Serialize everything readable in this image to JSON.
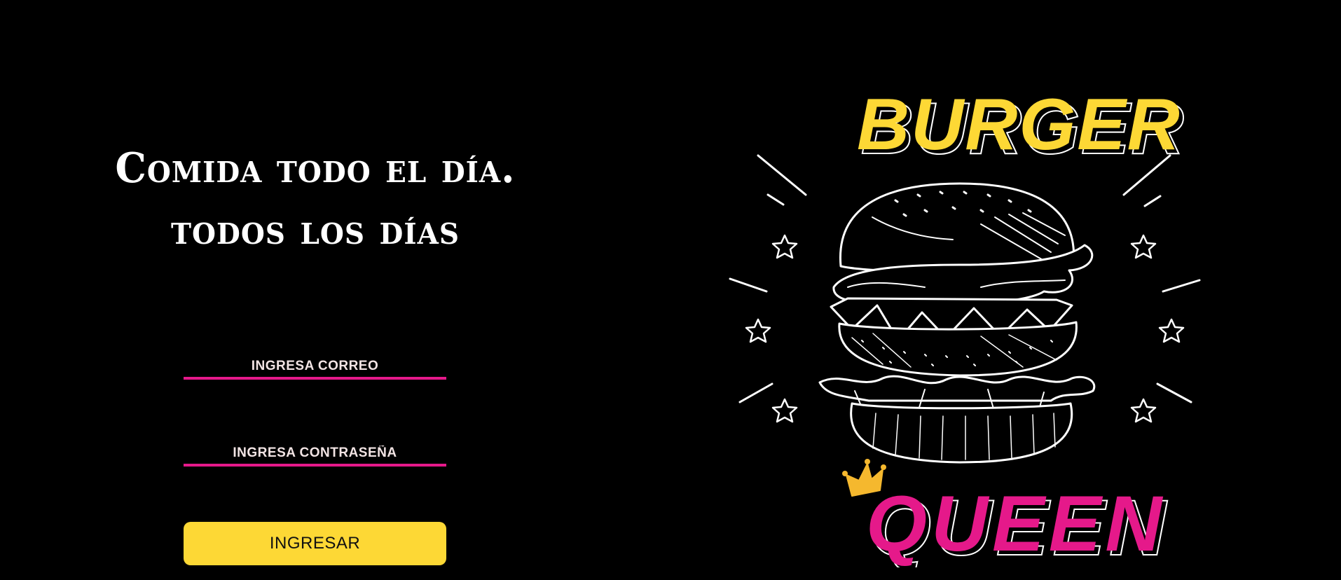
{
  "tagline": {
    "line1": "Comida todo el día.",
    "line2": "todos los días"
  },
  "login": {
    "email_placeholder": "INGRESA CORREO",
    "password_placeholder": "INGRESA CONTRASEÑA",
    "submit_label": "INGRESAR"
  },
  "logo": {
    "word_top": "BURGER",
    "word_bottom": "QUEEN",
    "icon": "burger-illustration",
    "crown_icon": "crown-icon"
  },
  "colors": {
    "background": "#000000",
    "accent_pink": "#e5198a",
    "accent_yellow": "#fdd835",
    "text": "#ffffff"
  }
}
